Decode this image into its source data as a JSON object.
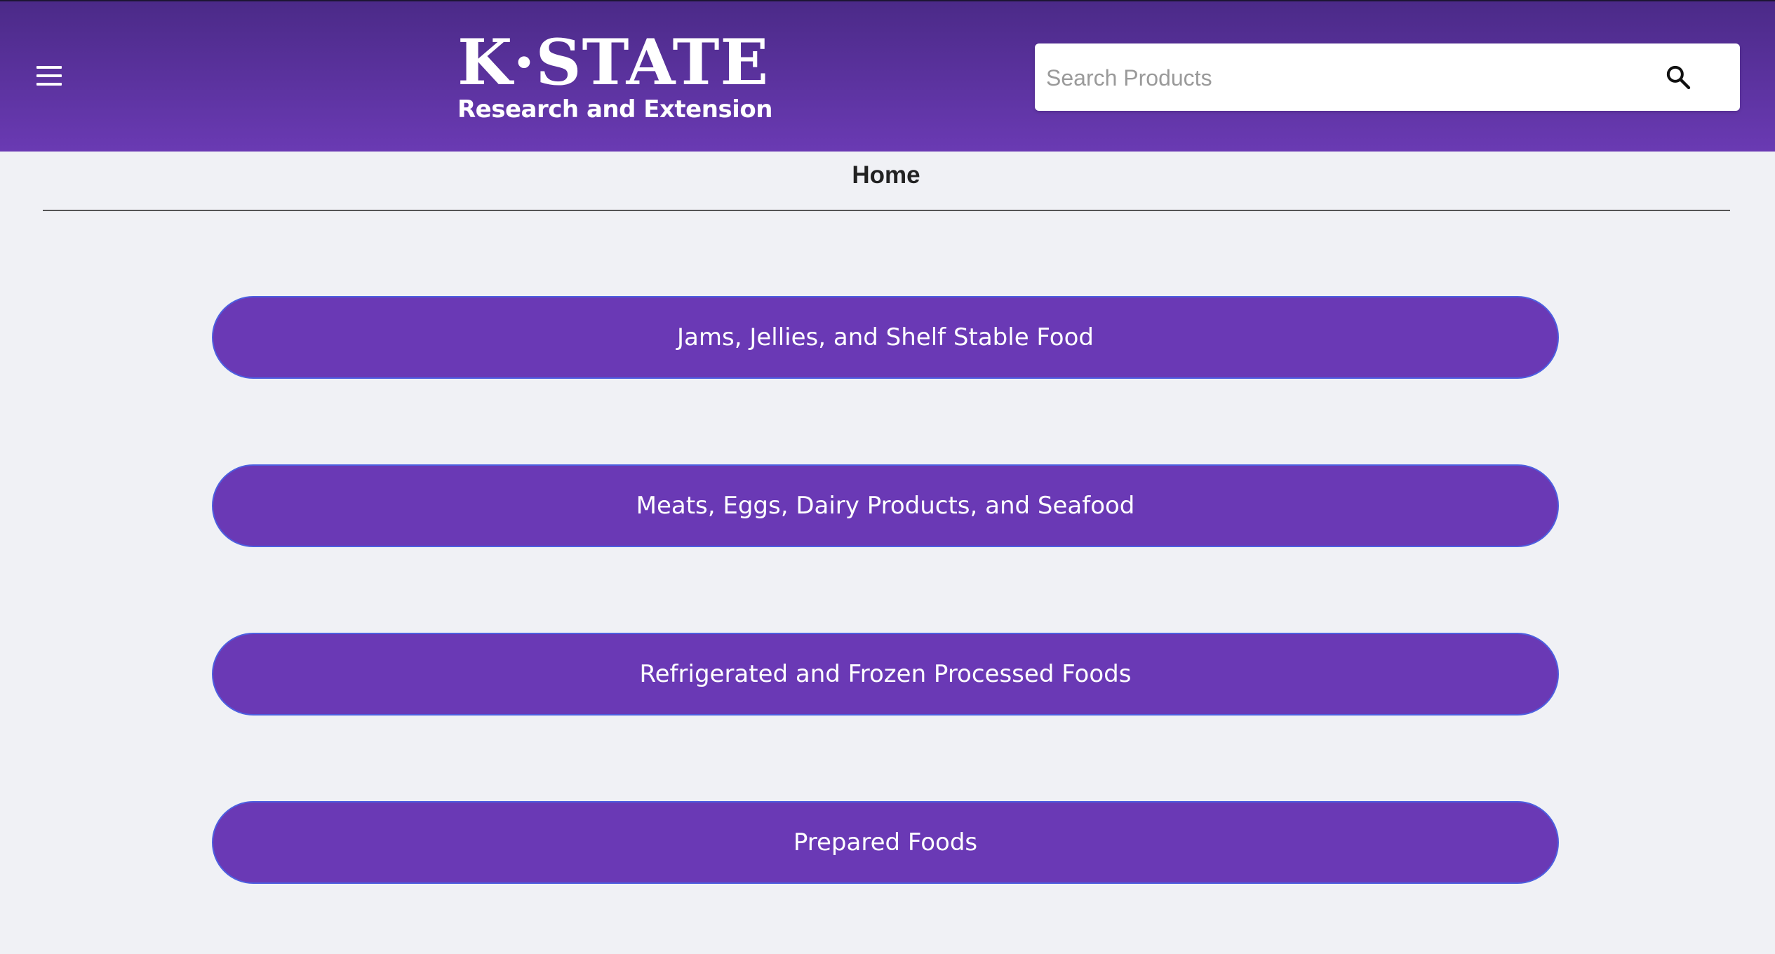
{
  "header": {
    "logo_main": "K·STATE",
    "logo_sub": "Research and Extension",
    "menu_icon": "hamburger-menu-icon",
    "search": {
      "placeholder": "Search Products",
      "value": "",
      "icon": "search-icon"
    }
  },
  "page": {
    "title": "Home"
  },
  "categories": [
    {
      "label": "Jams, Jellies, and Shelf Stable Food"
    },
    {
      "label": "Meats, Eggs, Dairy Products, and Seafood"
    },
    {
      "label": "Refrigerated and Frozen Processed Foods"
    },
    {
      "label": "Prepared Foods"
    }
  ],
  "colors": {
    "header_top": "#4b2a88",
    "header_bottom": "#6a3ab3",
    "button_fill": "#6a39b5",
    "button_border": "#4d5fe0",
    "background": "#f0f1f5"
  }
}
